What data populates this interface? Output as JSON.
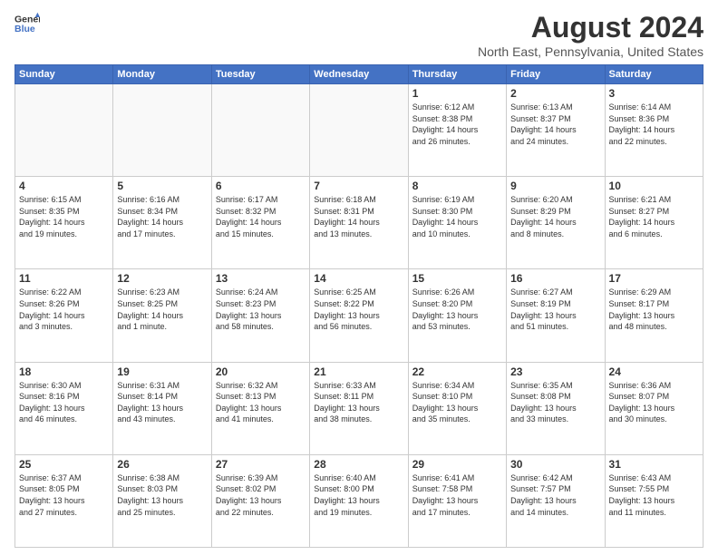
{
  "header": {
    "logo_line1": "General",
    "logo_line2": "Blue",
    "title": "August 2024",
    "subtitle": "North East, Pennsylvania, United States"
  },
  "weekdays": [
    "Sunday",
    "Monday",
    "Tuesday",
    "Wednesday",
    "Thursday",
    "Friday",
    "Saturday"
  ],
  "weeks": [
    [
      {
        "day": "",
        "info": ""
      },
      {
        "day": "",
        "info": ""
      },
      {
        "day": "",
        "info": ""
      },
      {
        "day": "",
        "info": ""
      },
      {
        "day": "1",
        "info": "Sunrise: 6:12 AM\nSunset: 8:38 PM\nDaylight: 14 hours\nand 26 minutes."
      },
      {
        "day": "2",
        "info": "Sunrise: 6:13 AM\nSunset: 8:37 PM\nDaylight: 14 hours\nand 24 minutes."
      },
      {
        "day": "3",
        "info": "Sunrise: 6:14 AM\nSunset: 8:36 PM\nDaylight: 14 hours\nand 22 minutes."
      }
    ],
    [
      {
        "day": "4",
        "info": "Sunrise: 6:15 AM\nSunset: 8:35 PM\nDaylight: 14 hours\nand 19 minutes."
      },
      {
        "day": "5",
        "info": "Sunrise: 6:16 AM\nSunset: 8:34 PM\nDaylight: 14 hours\nand 17 minutes."
      },
      {
        "day": "6",
        "info": "Sunrise: 6:17 AM\nSunset: 8:32 PM\nDaylight: 14 hours\nand 15 minutes."
      },
      {
        "day": "7",
        "info": "Sunrise: 6:18 AM\nSunset: 8:31 PM\nDaylight: 14 hours\nand 13 minutes."
      },
      {
        "day": "8",
        "info": "Sunrise: 6:19 AM\nSunset: 8:30 PM\nDaylight: 14 hours\nand 10 minutes."
      },
      {
        "day": "9",
        "info": "Sunrise: 6:20 AM\nSunset: 8:29 PM\nDaylight: 14 hours\nand 8 minutes."
      },
      {
        "day": "10",
        "info": "Sunrise: 6:21 AM\nSunset: 8:27 PM\nDaylight: 14 hours\nand 6 minutes."
      }
    ],
    [
      {
        "day": "11",
        "info": "Sunrise: 6:22 AM\nSunset: 8:26 PM\nDaylight: 14 hours\nand 3 minutes."
      },
      {
        "day": "12",
        "info": "Sunrise: 6:23 AM\nSunset: 8:25 PM\nDaylight: 14 hours\nand 1 minute."
      },
      {
        "day": "13",
        "info": "Sunrise: 6:24 AM\nSunset: 8:23 PM\nDaylight: 13 hours\nand 58 minutes."
      },
      {
        "day": "14",
        "info": "Sunrise: 6:25 AM\nSunset: 8:22 PM\nDaylight: 13 hours\nand 56 minutes."
      },
      {
        "day": "15",
        "info": "Sunrise: 6:26 AM\nSunset: 8:20 PM\nDaylight: 13 hours\nand 53 minutes."
      },
      {
        "day": "16",
        "info": "Sunrise: 6:27 AM\nSunset: 8:19 PM\nDaylight: 13 hours\nand 51 minutes."
      },
      {
        "day": "17",
        "info": "Sunrise: 6:29 AM\nSunset: 8:17 PM\nDaylight: 13 hours\nand 48 minutes."
      }
    ],
    [
      {
        "day": "18",
        "info": "Sunrise: 6:30 AM\nSunset: 8:16 PM\nDaylight: 13 hours\nand 46 minutes."
      },
      {
        "day": "19",
        "info": "Sunrise: 6:31 AM\nSunset: 8:14 PM\nDaylight: 13 hours\nand 43 minutes."
      },
      {
        "day": "20",
        "info": "Sunrise: 6:32 AM\nSunset: 8:13 PM\nDaylight: 13 hours\nand 41 minutes."
      },
      {
        "day": "21",
        "info": "Sunrise: 6:33 AM\nSunset: 8:11 PM\nDaylight: 13 hours\nand 38 minutes."
      },
      {
        "day": "22",
        "info": "Sunrise: 6:34 AM\nSunset: 8:10 PM\nDaylight: 13 hours\nand 35 minutes."
      },
      {
        "day": "23",
        "info": "Sunrise: 6:35 AM\nSunset: 8:08 PM\nDaylight: 13 hours\nand 33 minutes."
      },
      {
        "day": "24",
        "info": "Sunrise: 6:36 AM\nSunset: 8:07 PM\nDaylight: 13 hours\nand 30 minutes."
      }
    ],
    [
      {
        "day": "25",
        "info": "Sunrise: 6:37 AM\nSunset: 8:05 PM\nDaylight: 13 hours\nand 27 minutes."
      },
      {
        "day": "26",
        "info": "Sunrise: 6:38 AM\nSunset: 8:03 PM\nDaylight: 13 hours\nand 25 minutes."
      },
      {
        "day": "27",
        "info": "Sunrise: 6:39 AM\nSunset: 8:02 PM\nDaylight: 13 hours\nand 22 minutes."
      },
      {
        "day": "28",
        "info": "Sunrise: 6:40 AM\nSunset: 8:00 PM\nDaylight: 13 hours\nand 19 minutes."
      },
      {
        "day": "29",
        "info": "Sunrise: 6:41 AM\nSunset: 7:58 PM\nDaylight: 13 hours\nand 17 minutes."
      },
      {
        "day": "30",
        "info": "Sunrise: 6:42 AM\nSunset: 7:57 PM\nDaylight: 13 hours\nand 14 minutes."
      },
      {
        "day": "31",
        "info": "Sunrise: 6:43 AM\nSunset: 7:55 PM\nDaylight: 13 hours\nand 11 minutes."
      }
    ]
  ]
}
